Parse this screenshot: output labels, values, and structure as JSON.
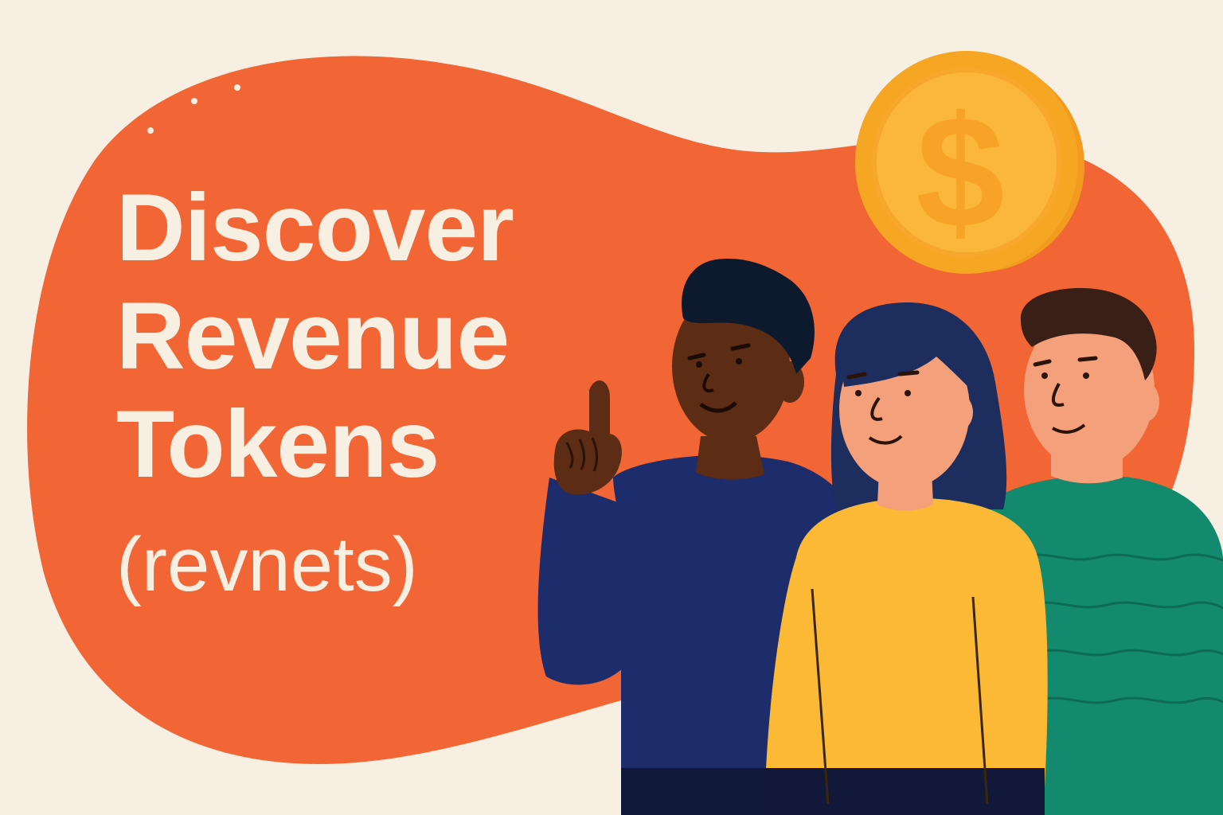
{
  "headline": {
    "line1": "Discover",
    "line2": "Revenue",
    "line3": "Tokens"
  },
  "subheadline": "(revnets)",
  "coin_symbol": "$",
  "icons": [
    "dollar-coin-icon",
    "sparkle-dots-icon"
  ],
  "colors": {
    "background": "#f7efe2",
    "blob": "#f26535",
    "text": "#f7efe2",
    "coin_outer": "#f5a623",
    "coin_face": "#fbb73a",
    "sweater_navy": "#1d2d6b",
    "sweater_yellow": "#fbb935",
    "sweater_green": "#138a6e"
  }
}
